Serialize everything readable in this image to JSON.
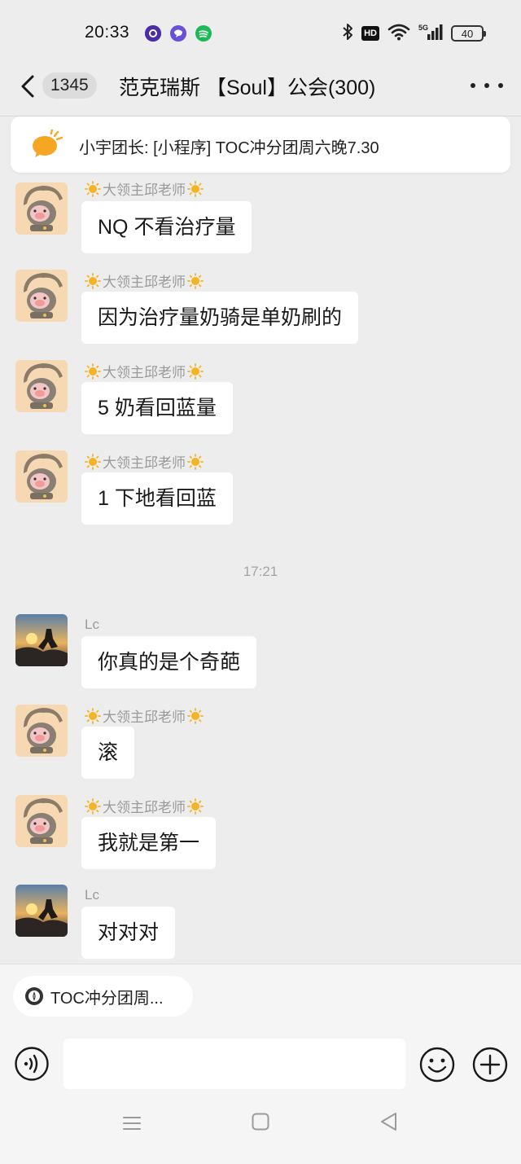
{
  "status_bar": {
    "time": "20:33",
    "notification_icons": [
      "purple-app-icon",
      "purple-chat-icon",
      "green-music-icon"
    ],
    "right_icons": [
      "bluetooth-icon",
      "hd-icon",
      "wifi-icon",
      "5g-signal-icon",
      "battery-icon"
    ],
    "hd_label": "HD",
    "battery_level": "40"
  },
  "nav": {
    "unread_count": "1345",
    "title": "范克瑞斯 【Soul】公会(300)"
  },
  "pinned": {
    "text": "小宇团长: [小程序] TOC冲分团周六晚7.30"
  },
  "sender_a": "大领主邱老师",
  "sender_b": "Lc",
  "messages": [
    {
      "sender": "大领主邱老师",
      "text": "NQ 不看治疗量"
    },
    {
      "sender": "大领主邱老师",
      "text": "因为治疗量奶骑是单奶刷的"
    },
    {
      "sender": "大领主邱老师",
      "text": "5 奶看回蓝量"
    },
    {
      "sender": "大领主邱老师",
      "text": "1 下地看回蓝"
    },
    {
      "sender": "Lc",
      "text": "你真的是个奇葩"
    },
    {
      "sender": "大领主邱老师",
      "text": "滚"
    },
    {
      "sender": "大领主邱老师",
      "text": "我就是第一"
    },
    {
      "sender": "Lc",
      "text": "对对对"
    }
  ],
  "timestamp": "17:21",
  "input_area": {
    "quick_chip": "TOC冲分团周...",
    "input_value": "",
    "input_placeholder": ""
  },
  "colors": {
    "background": "#ededed",
    "bubble": "#ffffff",
    "pinned_icon": "#f5a623"
  }
}
